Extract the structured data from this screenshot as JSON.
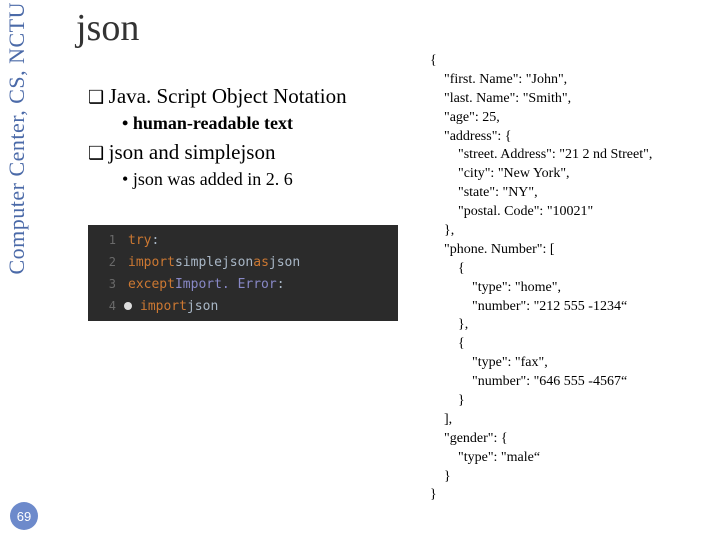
{
  "sidebar": "Computer Center, CS, NCTU",
  "slide_number": "69",
  "title": "json",
  "outline": {
    "item1": {
      "label": "Java. Script Object Notation",
      "bullets": [
        "human-readable text"
      ]
    },
    "item2": {
      "label": "json and simplejson",
      "bullets": [
        "json was added in 2. 6"
      ]
    }
  },
  "code": {
    "lines": [
      {
        "n": "1",
        "tokens": [
          {
            "t": "try",
            "c": "orange"
          },
          {
            "t": ":",
            "c": "white"
          }
        ]
      },
      {
        "n": "2",
        "tokens": [
          {
            "t": "    import ",
            "c": "orange"
          },
          {
            "t": "simplejson ",
            "c": "white"
          },
          {
            "t": "as ",
            "c": "orange"
          },
          {
            "t": "json",
            "c": "white"
          }
        ]
      },
      {
        "n": "3",
        "tokens": [
          {
            "t": "except ",
            "c": "orange"
          },
          {
            "t": "Import. Error",
            "c": "exc"
          },
          {
            "t": ":",
            "c": "white"
          }
        ]
      },
      {
        "n": "4",
        "dot": true,
        "tokens": [
          {
            "t": "    import ",
            "c": "orange"
          },
          {
            "t": "json",
            "c": "white"
          }
        ]
      }
    ]
  },
  "json_example": "{\n    \"first. Name\": \"John\",\n    \"last. Name\": \"Smith\",\n    \"age\": 25,\n    \"address\": {\n        \"street. Address\": \"21 2 nd Street\",\n        \"city\": \"New York\",\n        \"state\": \"NY\",\n        \"postal. Code\": \"10021\"\n    },\n    \"phone. Number\": [\n        {\n            \"type\": \"home\",\n            \"number\": \"212 555 -1234“\n        },\n        {\n            \"type\": \"fax\",\n            \"number\": \"646 555 -4567“\n        }\n    ],\n    \"gender\": {\n        \"type\": \"male“\n    }\n}"
}
